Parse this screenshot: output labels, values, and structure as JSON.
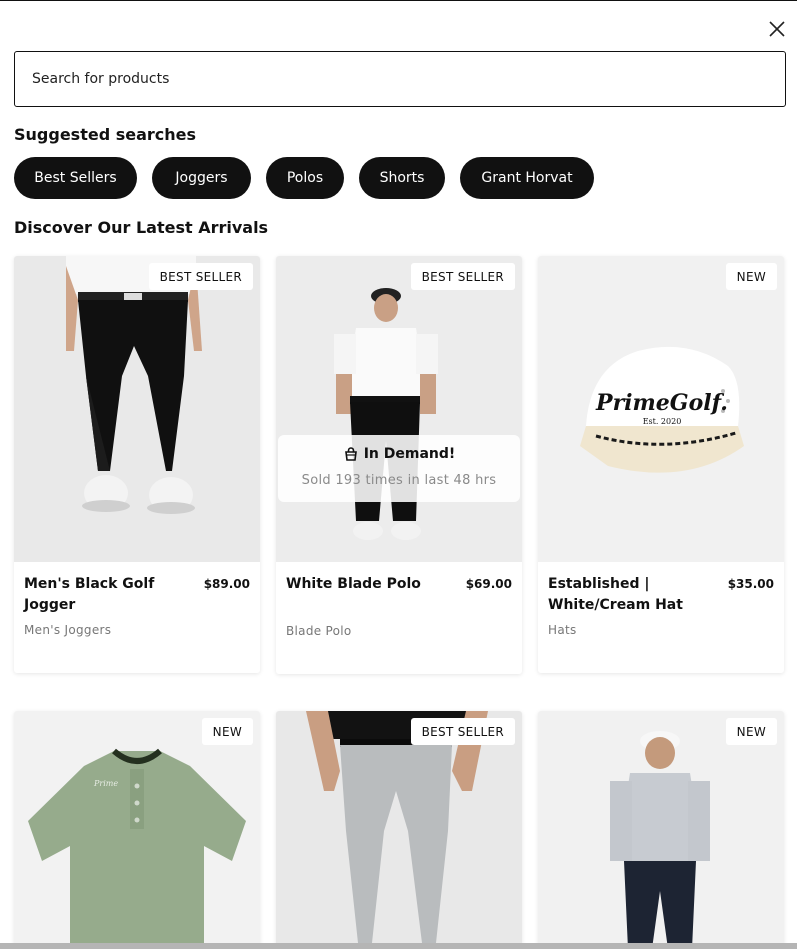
{
  "search": {
    "placeholder": "Search for products",
    "value": ""
  },
  "suggested": {
    "heading": "Suggested searches",
    "chips": [
      "Best Sellers",
      "Joggers",
      "Polos",
      "Shorts",
      "Grant Horvat"
    ]
  },
  "arrivals": {
    "heading": "Discover Our Latest Arrivals",
    "products": [
      {
        "badge": "BEST SELLER",
        "title": "Men's Black Golf Jogger",
        "price": "$89.00",
        "category": "Men's Joggers"
      },
      {
        "badge": "BEST SELLER",
        "title": "White Blade Polo",
        "price": "$69.00",
        "category": "Blade Polo",
        "demand": {
          "title": "In Demand!",
          "subtitle": "Sold 193 times in last 48 hrs"
        }
      },
      {
        "badge": "NEW",
        "title": "Established | White/Cream Hat",
        "price": "$35.00",
        "category": "Hats",
        "logo_text": "PrimeGolf. Est. 2020"
      },
      {
        "badge": "NEW"
      },
      {
        "badge": "BEST SELLER"
      },
      {
        "badge": "NEW"
      }
    ]
  },
  "icons": {
    "close": "close-icon",
    "bag": "shopping-bag-icon"
  }
}
